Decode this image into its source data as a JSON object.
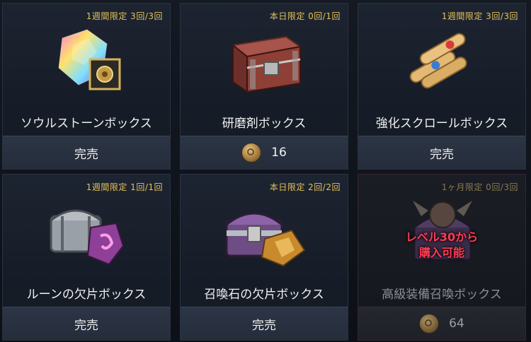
{
  "cards": [
    {
      "limit": "1週間限定 3回/3回",
      "name": "ソウルストーンボックス",
      "price": "完売",
      "icon": "soulstone-box-icon"
    },
    {
      "limit": "本日限定 0回/1回",
      "name": "研磨剤ボックス",
      "price": "16",
      "icon": "abrasive-box-icon"
    },
    {
      "limit": "1週間限定 3回/3回",
      "name": "強化スクロールボックス",
      "price": "完売",
      "icon": "scroll-box-icon"
    },
    {
      "limit": "1週間限定 1回/1回",
      "name": "ルーンの欠片ボックス",
      "price": "完売",
      "icon": "rune-fragment-box-icon"
    },
    {
      "limit": "本日限定 2回/2回",
      "name": "召喚石の欠片ボックス",
      "price": "完売",
      "icon": "summon-stone-fragment-box-icon"
    },
    {
      "limit": "1ヶ月限定 0回/3回",
      "name": "高級装備召喚ボックス",
      "price": "64",
      "icon": "premium-equipment-box-icon",
      "lock_text_1": "レベル30から",
      "lock_text_2": "購入可能"
    }
  ],
  "colors": {
    "limit": "#e6c25a",
    "lock_text": "#ff3b52",
    "coin": "#c9a261"
  }
}
